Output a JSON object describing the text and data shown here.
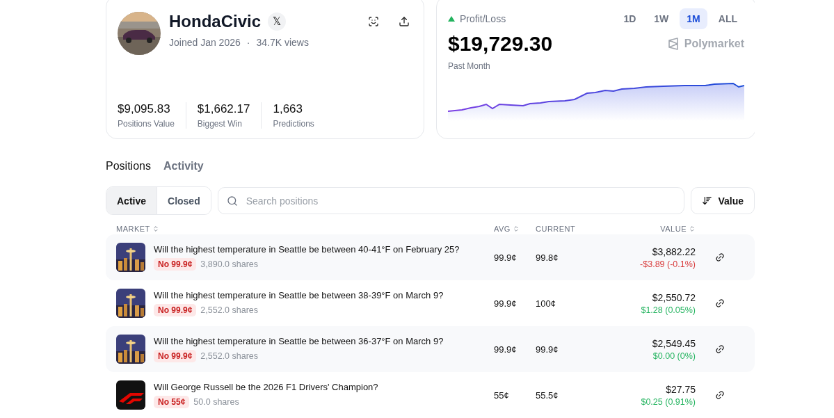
{
  "profile": {
    "name": "HondaCivic",
    "social_badge": "𝕏",
    "joined": "Joined Jan 2026",
    "separator": "·",
    "views": "34.7K views",
    "stats": [
      {
        "value": "$9,095.83",
        "label": "Positions Value"
      },
      {
        "value": "$1,662.17",
        "label": "Biggest Win"
      },
      {
        "value": "1,663",
        "label": "Predictions"
      }
    ]
  },
  "pnl": {
    "label": "Profit/Loss",
    "amount": "$19,729.30",
    "period": "Past Month",
    "brand": "Polymarket",
    "ranges": [
      {
        "label": "1D",
        "selected": false
      },
      {
        "label": "1W",
        "selected": false
      },
      {
        "label": "1M",
        "selected": true
      },
      {
        "label": "ALL",
        "selected": false
      }
    ]
  },
  "tabs": [
    {
      "label": "Positions",
      "selected": true
    },
    {
      "label": "Activity",
      "selected": false
    }
  ],
  "filters": [
    {
      "label": "Active",
      "selected": true
    },
    {
      "label": "Closed",
      "selected": false
    }
  ],
  "search": {
    "placeholder": "Search positions"
  },
  "sort_button": "Value",
  "table": {
    "columns": [
      {
        "label": "MARKET",
        "sortable": true
      },
      {
        "label": "AVG",
        "sortable": true
      },
      {
        "label": "CURRENT",
        "sortable": false
      },
      {
        "label": "VALUE",
        "sortable": true
      }
    ],
    "rows": [
      {
        "kind": "city",
        "title": "Will the highest temperature in Seattle be between 40-41°F on February 25?",
        "outcome": "No 99.9¢",
        "shares": "3,890.0 shares",
        "avg": "99.9¢",
        "current": "99.8¢",
        "value": "$3,882.22",
        "change": {
          "text": "-$3.89 (-0.1%)",
          "color": "#d83a3a"
        }
      },
      {
        "kind": "city",
        "title": "Will the highest temperature in Seattle be between 38-39°F on March 9?",
        "outcome": "No 99.9¢",
        "shares": "2,552.0 shares",
        "avg": "99.9¢",
        "current": "100¢",
        "value": "$2,550.72",
        "change": {
          "text": "$1.28 (0.05%)",
          "color": "#22b35e"
        }
      },
      {
        "kind": "city",
        "title": "Will the highest temperature in Seattle be between 36-37°F on March 9?",
        "outcome": "No 99.9¢",
        "shares": "2,552.0 shares",
        "avg": "99.9¢",
        "current": "99.9¢",
        "value": "$2,549.45",
        "change": {
          "text": "$0.00 (0%)",
          "color": "#22b35e"
        }
      },
      {
        "kind": "racing",
        "title": "Will George Russell be the 2026 F1 Drivers' Champion?",
        "outcome": "No 55¢",
        "shares": "50.0 shares",
        "avg": "55¢",
        "current": "55.5¢",
        "value": "$27.75",
        "change": {
          "text": "$0.25 (0.91%)",
          "color": "#22b35e"
        }
      }
    ]
  }
}
